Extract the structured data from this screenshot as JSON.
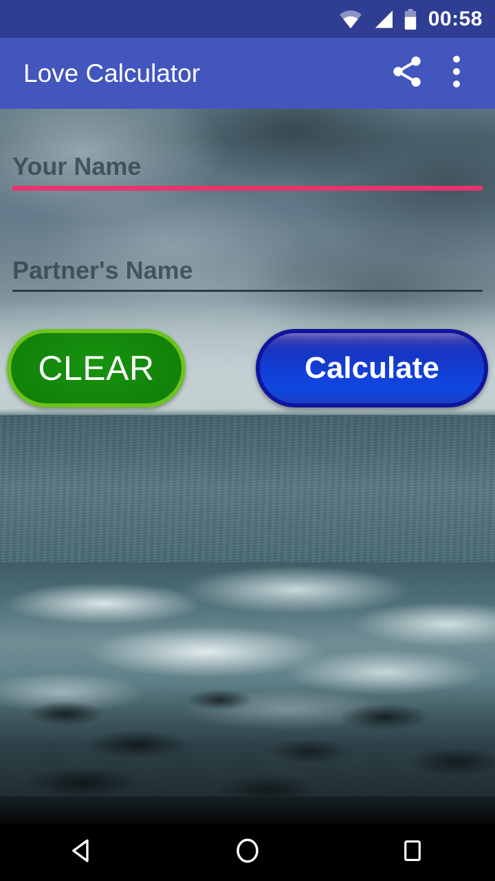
{
  "status_bar": {
    "time": "00:58",
    "icons": [
      "wifi-icon",
      "cellular-signal-icon",
      "battery-icon"
    ],
    "background_color": "#2f3d93"
  },
  "app_bar": {
    "title": "Love Calculator",
    "background_color": "#4256bd",
    "title_color": "#ffffff",
    "actions": [
      {
        "name": "share-icon",
        "label": "Share"
      },
      {
        "name": "overflow-menu-icon",
        "label": "More options"
      }
    ]
  },
  "form": {
    "fields": [
      {
        "name": "your-name",
        "placeholder": "Your Name",
        "value": "",
        "focused": true,
        "underline_color": "#e8336d"
      },
      {
        "name": "partner-name",
        "placeholder": "Partner's Name",
        "value": "",
        "focused": false,
        "underline_color": "#2e3c41"
      }
    ],
    "hint_color": "#2d3a3f"
  },
  "buttons": {
    "clear": {
      "label": "CLEAR",
      "fill_color": "#128209",
      "border_color": "#6cc41b",
      "text_color": "#ffffff"
    },
    "calculate": {
      "label": "Calculate",
      "fill_color": "#1240d8",
      "border_color": "#11149c",
      "text_color": "#ffffff"
    }
  },
  "nav_bar": {
    "background_color": "#000000",
    "buttons": [
      {
        "name": "back-icon",
        "label": "Back"
      },
      {
        "name": "home-icon",
        "label": "Home"
      },
      {
        "name": "recents-icon",
        "label": "Recents"
      }
    ]
  }
}
